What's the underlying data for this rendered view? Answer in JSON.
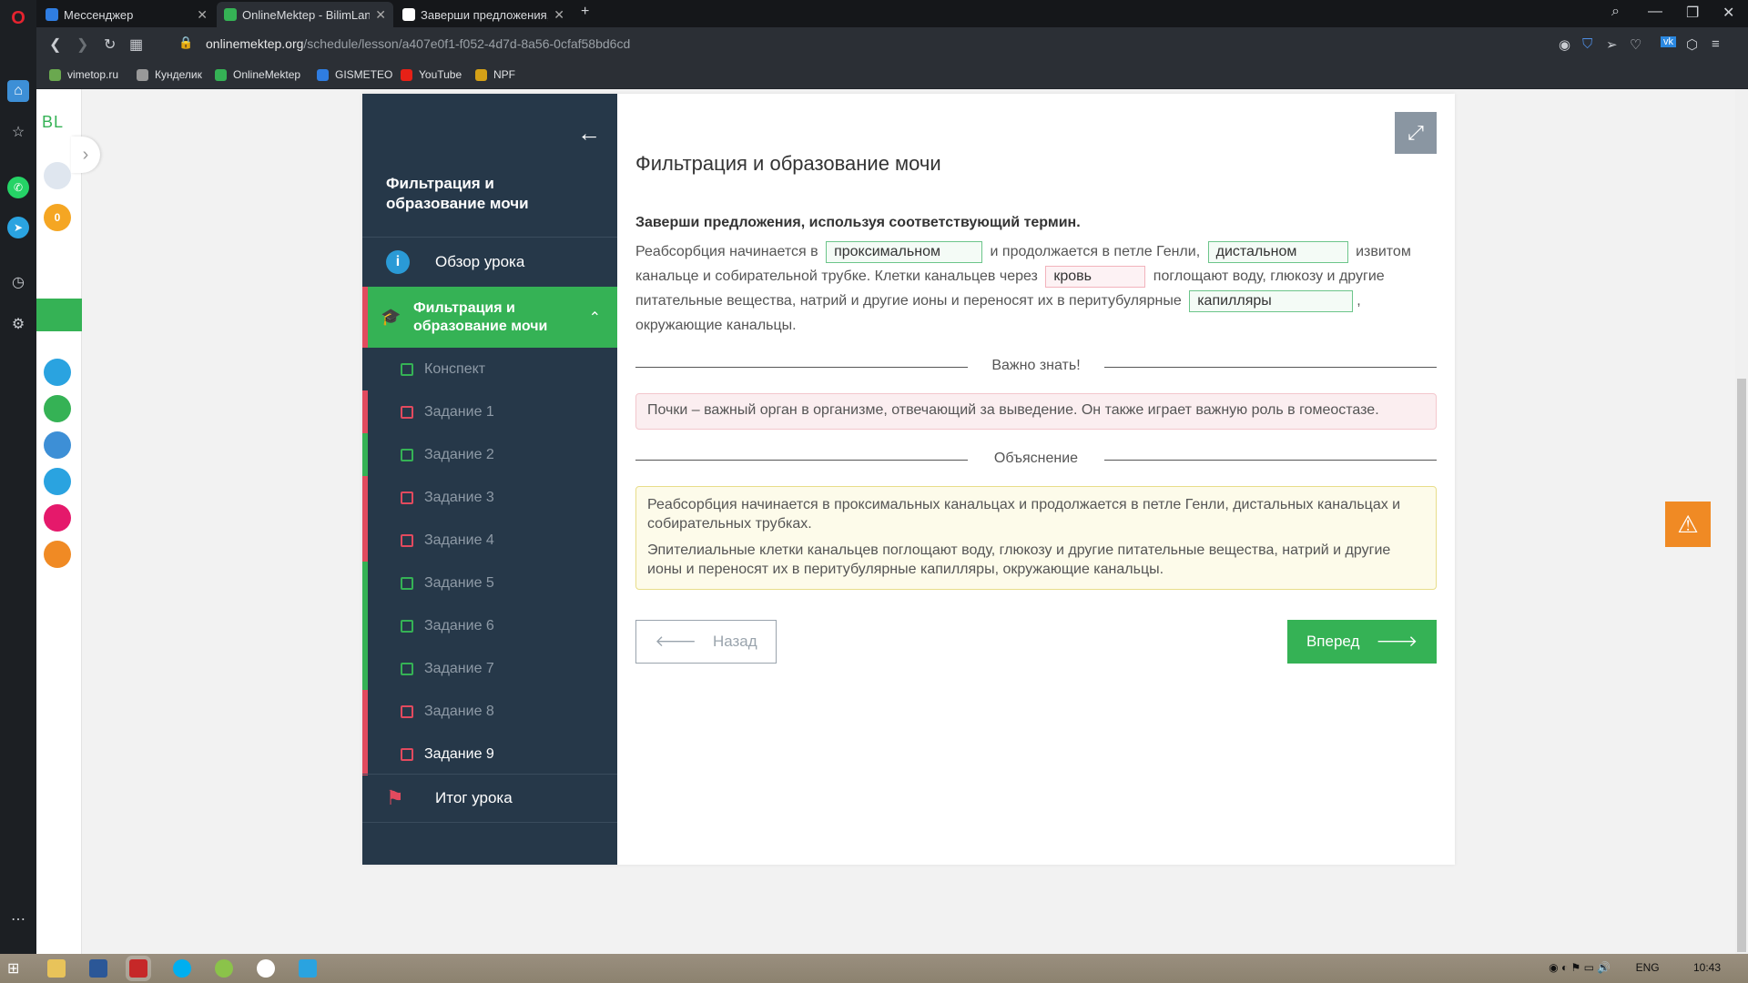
{
  "browser": {
    "tabs": [
      {
        "title": "Мессенджер",
        "favicon_color": "#2f7de1"
      },
      {
        "title": "OnlineMektep - BilimLand",
        "favicon_color": "#35b255"
      },
      {
        "title": "Заверши предложения, и",
        "favicon_color": "#ffffff"
      }
    ],
    "url_domain": "onlinemektep.org",
    "url_path": "/schedule/lesson/a407e0f1-f052-4d7d-8a56-0cfaf58bd6cd",
    "bookmarks": [
      {
        "label": "vimetop.ru",
        "color": "#6aa84f"
      },
      {
        "label": "Кунделик",
        "color": "#999999"
      },
      {
        "label": "OnlineMektep",
        "color": "#35b255"
      },
      {
        "label": "GISMETEO",
        "color": "#2f7de1"
      },
      {
        "label": "YouTube",
        "color": "#e62117"
      },
      {
        "label": "NPF",
        "color": "#d4a017"
      }
    ]
  },
  "site_rail": {
    "logo": "BL",
    "coins": "0"
  },
  "lesson_nav": {
    "title": "Фильтрация и образование мочи",
    "overview": "Обзор урока",
    "section": "Фильтрация и образование мочи",
    "items": [
      {
        "label": "Конспект",
        "status": "neutral"
      },
      {
        "label": "Задание 1",
        "status": "wrong"
      },
      {
        "label": "Задание 2",
        "status": "correct"
      },
      {
        "label": "Задание 3",
        "status": "wrong"
      },
      {
        "label": "Задание 4",
        "status": "wrong"
      },
      {
        "label": "Задание 5",
        "status": "correct"
      },
      {
        "label": "Задание 6",
        "status": "correct"
      },
      {
        "label": "Задание 7",
        "status": "correct"
      },
      {
        "label": "Задание 8",
        "status": "wrong"
      },
      {
        "label": "Задание 9",
        "status": "wrong"
      }
    ],
    "summary": "Итог урока"
  },
  "content": {
    "heading": "Фильтрация и образование мочи",
    "prompt": "Заверши предложения, используя соответствующий термин.",
    "sentence": {
      "t1": "Реабсорбция начинается в",
      "b1": "проксимальном",
      "t2": "и продолжается в петле Генли,",
      "b2": "дистальном",
      "t3": "извитом канальце и собирательной трубке. Клетки канальцев через",
      "b3": "кровь",
      "t4": "поглощают воду, глюкозу и другие питательные вещества, натрий и другие ионы и переносят их в перитубулярные",
      "b4": "капилляры",
      "t5": ", окружающие канальцы."
    },
    "important_label": "Важно знать!",
    "important_text": "Почки – важный орган в организме, отвечающий за выведение. Он также играет важную роль в гомеостазе.",
    "explanation_label": "Объяснение",
    "explanation_p1": "Реабсорбция начинается в проксимальных канальцах и продолжается в петле Генли, дистальных канальцах и собирательных трубках.",
    "explanation_p2": "Эпителиальные клетки канальцев поглощают воду, глюкозу и другие питательные вещества, натрий и другие ионы и переносят их в перитубулярные капилляры, окружающие канальцы.",
    "prev_label": "Назад",
    "next_label": "Вперед"
  },
  "taskbar": {
    "lang": "ENG",
    "time": "10:43"
  },
  "colors": {
    "accent_green": "#35b255",
    "wrong_red": "#e24a5e",
    "nav_bg": "#263849"
  }
}
